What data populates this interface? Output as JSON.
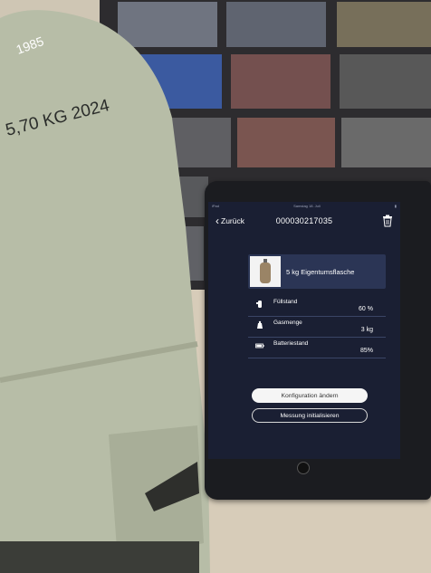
{
  "cylinder": {
    "stamp_text": "5,70 KG 2024",
    "stamp_text_top": "1985"
  },
  "app": {
    "status_left": "iPad",
    "status_center": "Samstag 18. Juli",
    "back_label": "Zurück",
    "title": "000030217035",
    "trash_icon": "trash-icon",
    "product_name": "5 kg Eigentumsflasche",
    "rows": [
      {
        "label": "Füllstand",
        "value": "60 %",
        "icon": "fill-level-icon"
      },
      {
        "label": "Gasmenge",
        "value": "3 kg",
        "icon": "scale-icon"
      },
      {
        "label": "Batteriestand",
        "value": "85%",
        "icon": "battery-icon"
      }
    ],
    "button_primary": "Konfiguration ändern",
    "button_secondary": "Messung initialisieren"
  },
  "colors": {
    "screen_bg": "#1a1f33",
    "card_bg": "#2b3555",
    "cylinder": "#b9bfa9"
  }
}
